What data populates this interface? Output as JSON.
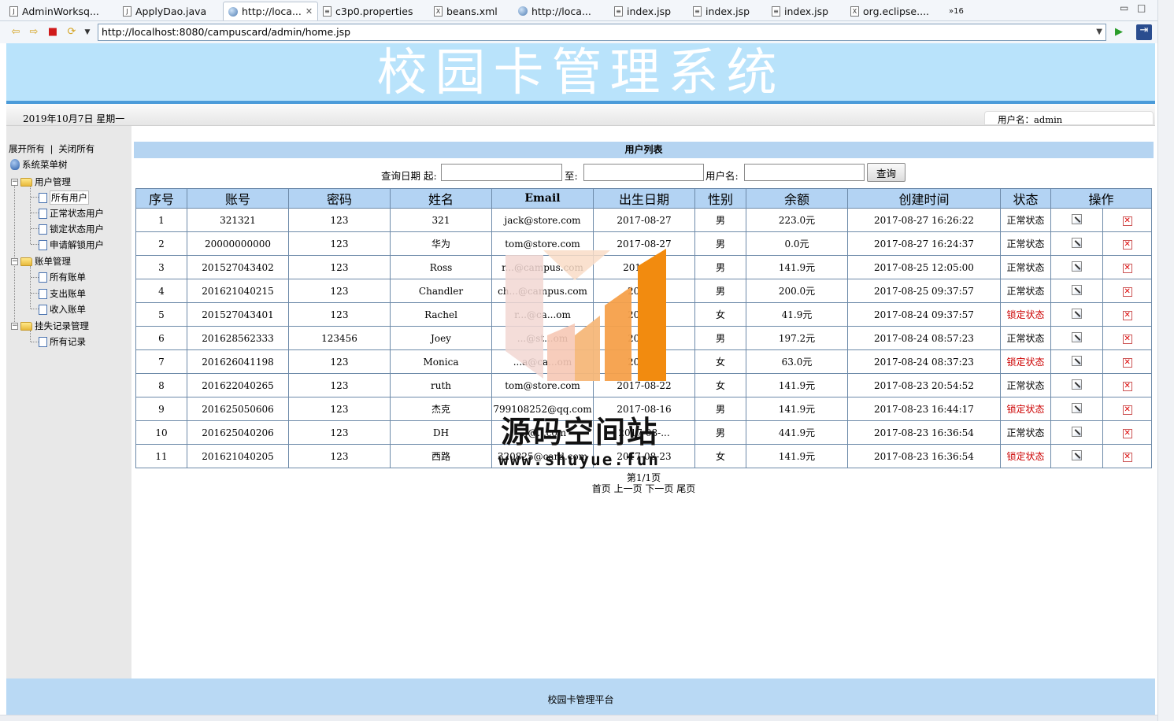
{
  "editor_tabs": [
    {
      "label": "AdminWorksq...",
      "icon": "java-file-icon"
    },
    {
      "label": "ApplyDao.java",
      "icon": "java-file-icon"
    },
    {
      "label": "http://loca...",
      "icon": "browser-globe-icon",
      "active": true
    },
    {
      "label": "c3p0.properties",
      "icon": "properties-file-icon"
    },
    {
      "label": "beans.xml",
      "icon": "xml-file-icon"
    },
    {
      "label": "http://loca...",
      "icon": "browser-globe-icon"
    },
    {
      "label": "index.jsp",
      "icon": "jsp-file-icon"
    },
    {
      "label": "index.jsp",
      "icon": "jsp-file-icon"
    },
    {
      "label": "index.jsp",
      "icon": "jsp-file-icon"
    },
    {
      "label": "org.eclipse....",
      "icon": "xml-file-icon"
    }
  ],
  "overflow_tabs": "»16",
  "browser": {
    "url": "http://localhost:8080/campuscard/admin/home.jsp"
  },
  "header": {
    "title": "校园卡管理系统",
    "date": "2019年10月7日 星期一",
    "user_label": "用户名：admin"
  },
  "sidebar": {
    "expand_all": "展开所有",
    "separator": "|",
    "collapse_all": "关闭所有",
    "root": "系统菜单树",
    "groups": [
      {
        "label": "用户管理",
        "items": [
          "所有用户",
          "正常状态用户",
          "锁定状态用户",
          "申请解锁用户"
        ]
      },
      {
        "label": "账单管理",
        "items": [
          "所有账单",
          "支出账单",
          "收入账单"
        ]
      },
      {
        "label": "挂失记录管理",
        "items": [
          "所有记录"
        ]
      }
    ]
  },
  "main": {
    "list_title": "用户列表",
    "search": {
      "date_from_label": "查询日期 起:",
      "date_to_label": "至:",
      "username_label": "用户名:",
      "button": "查询"
    },
    "columns": [
      "序号",
      "账号",
      "密码",
      "姓名",
      "Email",
      "出生日期",
      "性别",
      "余额",
      "创建时间",
      "状态",
      "操作"
    ],
    "rows": [
      {
        "no": "1",
        "account": "321321",
        "password": "123",
        "name": "321",
        "email": "jack@store.com",
        "birth": "2017-08-27",
        "gender": "男",
        "balance": "223.0元",
        "created": "2017-08-27 16:26:22",
        "status": "正常状态",
        "locked": false
      },
      {
        "no": "2",
        "account": "20000000000",
        "password": "123",
        "name": "华为",
        "email": "tom@store.com",
        "birth": "2017-08-27",
        "gender": "男",
        "balance": "0.0元",
        "created": "2017-08-27 16:24:37",
        "status": "正常状态",
        "locked": false
      },
      {
        "no": "3",
        "account": "201527043402",
        "password": "123",
        "name": "Ross",
        "email": "r...@campus.com",
        "birth": "2017-0...",
        "gender": "男",
        "balance": "141.9元",
        "created": "2017-08-25 12:05:00",
        "status": "正常状态",
        "locked": false
      },
      {
        "no": "4",
        "account": "201621040215",
        "password": "123",
        "name": "Chandler",
        "email": "ch...@campus.com",
        "birth": "2017...",
        "gender": "男",
        "balance": "200.0元",
        "created": "2017-08-25 09:37:57",
        "status": "正常状态",
        "locked": false
      },
      {
        "no": "5",
        "account": "201527043401",
        "password": "123",
        "name": "Rachel",
        "email": "r...@ca...om",
        "birth": "2017...",
        "gender": "女",
        "balance": "41.9元",
        "created": "2017-08-24 09:37:57",
        "status": "锁定状态",
        "locked": true
      },
      {
        "no": "6",
        "account": "201628562333",
        "password": "123456",
        "name": "Joey",
        "email": "...@st...om",
        "birth": "2017...",
        "gender": "男",
        "balance": "197.2元",
        "created": "2017-08-24 08:57:23",
        "status": "正常状态",
        "locked": false
      },
      {
        "no": "7",
        "account": "201626041198",
        "password": "123",
        "name": "Monica",
        "email": "...a@ca...om",
        "birth": "2017...",
        "gender": "女",
        "balance": "63.0元",
        "created": "2017-08-24 08:37:23",
        "status": "锁定状态",
        "locked": true
      },
      {
        "no": "8",
        "account": "201622040265",
        "password": "123",
        "name": "ruth",
        "email": "tom@store.com",
        "birth": "2017-08-22",
        "gender": "女",
        "balance": "141.9元",
        "created": "2017-08-23 20:54:52",
        "status": "正常状态",
        "locked": false
      },
      {
        "no": "9",
        "account": "201625050606",
        "password": "123",
        "name": "杰克",
        "email": "799108252@qq.com",
        "birth": "2017-08-16",
        "gender": "男",
        "balance": "141.9元",
        "created": "2017-08-23 16:44:17",
        "status": "锁定状态",
        "locked": true
      },
      {
        "no": "10",
        "account": "201625040206",
        "password": "123",
        "name": "DH",
        "email": "...@...com",
        "birth": "2017-08-...",
        "gender": "男",
        "balance": "441.9元",
        "created": "2017-08-23 16:36:54",
        "status": "正常状态",
        "locked": false
      },
      {
        "no": "11",
        "account": "201621040205",
        "password": "123",
        "name": "西路",
        "email": "320825@card.com",
        "birth": "2017-08-23",
        "gender": "女",
        "balance": "141.9元",
        "created": "2017-08-23 16:36:54",
        "status": "锁定状态",
        "locked": true
      }
    ],
    "pager": {
      "page_info": "第1/1页",
      "first": "首页",
      "prev": "上一页",
      "next": "下一页",
      "last": "尾页"
    }
  },
  "watermark": {
    "name": "源码空间站",
    "site": "www.shuyue.fun"
  },
  "footer": {
    "text": "校园卡管理平台"
  },
  "colors": {
    "header_bg": "#b9e3fb",
    "table_header_bg": "#b3d3f3",
    "locked_status": "#cc0000",
    "footer_bg": "#b9d9f4"
  }
}
